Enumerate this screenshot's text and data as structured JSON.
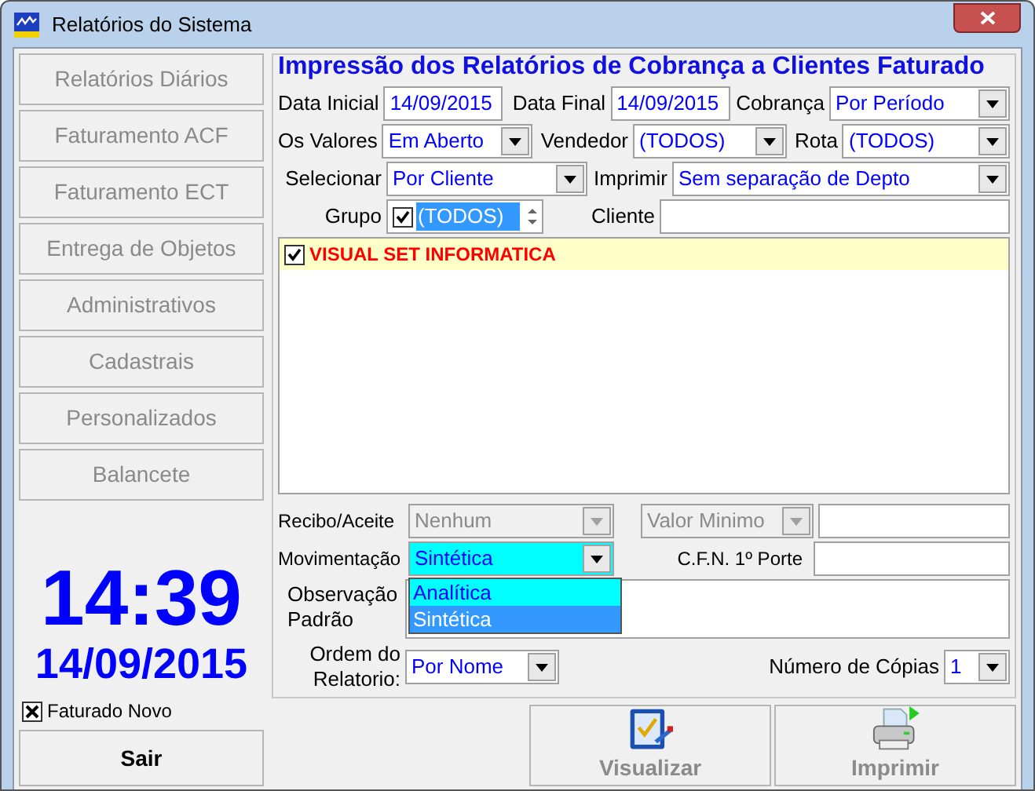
{
  "window": {
    "title": "Relatórios do Sistema"
  },
  "sidebar": {
    "items": [
      {
        "label": "Relatórios Diários",
        "disabled": true
      },
      {
        "label": "Faturamento ACF",
        "disabled": true
      },
      {
        "label": "Faturamento ECT",
        "disabled": true
      },
      {
        "label": "Entrega de Objetos",
        "disabled": true
      },
      {
        "label": "Administrativos",
        "disabled": true
      },
      {
        "label": "Cadastrais",
        "disabled": true
      },
      {
        "label": "Personalizados",
        "disabled": true
      },
      {
        "label": "Balancete",
        "disabled": true
      }
    ]
  },
  "clock": {
    "time": "14:39",
    "date": "14/09/2015"
  },
  "faturado_novo": {
    "label": "Faturado Novo",
    "checked": true
  },
  "exit_button": {
    "label": "Sair"
  },
  "form": {
    "title": "Impressão dos Relatórios de Cobrança a Clientes Faturado",
    "data_inicial": {
      "label": "Data Inicial",
      "value": "14/09/2015"
    },
    "data_final": {
      "label": "Data Final",
      "value": "14/09/2015"
    },
    "cobranca": {
      "label": "Cobrança",
      "value": "Por Período"
    },
    "os_valores": {
      "label": "Os Valores",
      "value": "Em Aberto"
    },
    "vendedor": {
      "label": "Vendedor",
      "value": "(TODOS)"
    },
    "rota": {
      "label": "Rota",
      "value": "(TODOS)"
    },
    "selecionar": {
      "label": "Selecionar",
      "value": "Por Cliente"
    },
    "imprimir": {
      "label": "Imprimir",
      "value": "Sem separação de Depto"
    },
    "grupo": {
      "label": "Grupo",
      "checked": true,
      "value": "(TODOS)"
    },
    "cliente": {
      "label": "Cliente"
    },
    "client_list": [
      {
        "label": "VISUAL SET INFORMATICA",
        "checked": true
      }
    ],
    "recibo_aceite": {
      "label": "Recibo/Aceite",
      "value": "Nenhum",
      "disabled": true
    },
    "valor_minimo": {
      "value": "Valor Minimo",
      "disabled": true
    },
    "movimentacao": {
      "label": "Movimentação",
      "value": "Sintética",
      "options": [
        {
          "label": "Analítica",
          "selected": false
        },
        {
          "label": "Sintética",
          "selected": true
        }
      ]
    },
    "cfn": {
      "label": "C.F.N. 1º Porte"
    },
    "observacao": {
      "label": "Observação Padrão"
    },
    "ordem": {
      "label": "Ordem do Relatorio:",
      "value": "Por Nome"
    },
    "copias": {
      "label": "Número de Cópias",
      "value": "1"
    }
  },
  "actions": [
    {
      "label": "Visualizar",
      "kind": "preview",
      "disabled": true
    },
    {
      "label": "Imprimir",
      "kind": "print",
      "disabled": true
    }
  ]
}
